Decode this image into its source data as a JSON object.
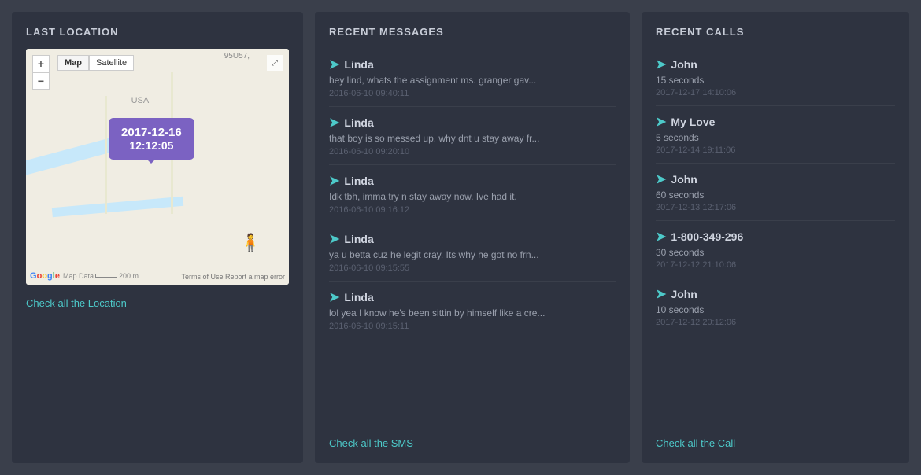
{
  "location_panel": {
    "title": "LAST LOCATION",
    "map": {
      "date": "2017-12-16",
      "time": "12:12:05",
      "top_label": "95U57,",
      "region_label": "USA",
      "zoom_in": "+",
      "zoom_out": "−",
      "map_type_options": [
        "Map",
        "Satellite"
      ],
      "scale_text": "200 m",
      "footer_left": "Map Data",
      "footer_right": "Terms of Use   Report a map error"
    },
    "check_link": "Check all the Location"
  },
  "messages_panel": {
    "title": "RECENT MESSAGES",
    "messages": [
      {
        "sender": "Linda",
        "text": "hey lind, whats the assignment ms. granger gav...",
        "timestamp": "2016-06-10 09:40:11"
      },
      {
        "sender": "Linda",
        "text": "that boy is so messed up. why dnt u stay away fr...",
        "timestamp": "2016-06-10 09:20:10"
      },
      {
        "sender": "Linda",
        "text": "Idk tbh, imma try n stay away now. Ive had it.",
        "timestamp": "2016-06-10 09:16:12"
      },
      {
        "sender": "Linda",
        "text": "ya u betta cuz he legit cray. Its why he got no frn...",
        "timestamp": "2016-06-10 09:15:55"
      },
      {
        "sender": "Linda",
        "text": "lol yea I know he's been sittin by himself like a cre...",
        "timestamp": "2016-06-10 09:15:11"
      }
    ],
    "check_link": "Check all the SMS"
  },
  "calls_panel": {
    "title": "RECENT CALLS",
    "calls": [
      {
        "name": "John",
        "duration": "15 seconds",
        "timestamp": "2017-12-17 14:10:06"
      },
      {
        "name": "My Love",
        "duration": "5 seconds",
        "timestamp": "2017-12-14 19:11:06"
      },
      {
        "name": "John",
        "duration": "60 seconds",
        "timestamp": "2017-12-13 12:17:06"
      },
      {
        "name": "1-800-349-296",
        "duration": "30 seconds",
        "timestamp": "2017-12-12 21:10:06"
      },
      {
        "name": "John",
        "duration": "10 seconds",
        "timestamp": "2017-12-12 20:12:06"
      }
    ],
    "check_link": "Check all the Call"
  },
  "icons": {
    "send_arrow": "➤",
    "plus": "+",
    "minus": "−",
    "expand": "⤢",
    "human": "🧍",
    "google_letters": [
      "G",
      "o",
      "o",
      "g",
      "l",
      "e"
    ]
  }
}
